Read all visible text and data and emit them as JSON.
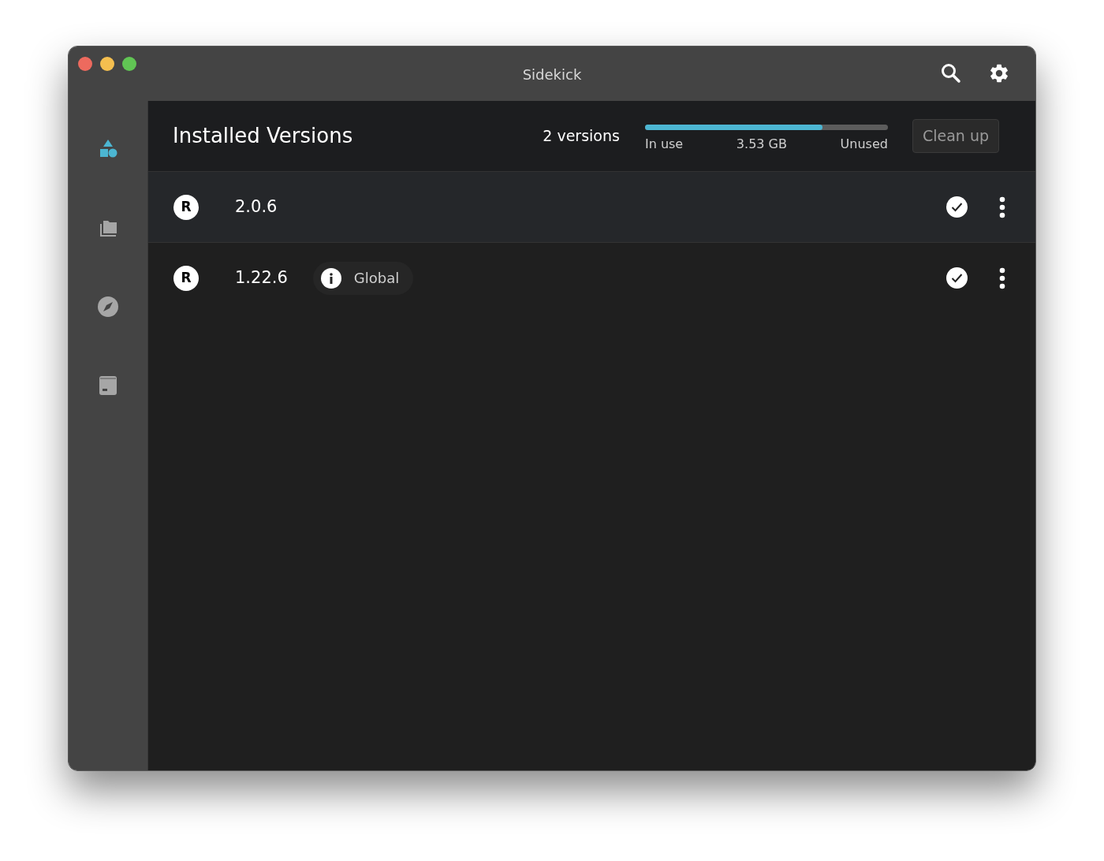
{
  "window": {
    "title": "Sidekick"
  },
  "sidebar": {
    "items": [
      {
        "kind": "shapes",
        "selected": true
      },
      {
        "kind": "folders",
        "selected": false
      },
      {
        "kind": "compass",
        "selected": false
      },
      {
        "kind": "archive",
        "selected": false
      }
    ]
  },
  "header": {
    "title": "Installed Versions",
    "count": "2 versions",
    "storage": {
      "level": 0.73,
      "in_use_label": "In use",
      "size": "3.53 GB",
      "unused_label": "Unused"
    },
    "cleanup_button": {
      "label": "Clean up",
      "disabled": true
    }
  },
  "versions": [
    {
      "badge": "R",
      "version": "2.0.6",
      "selected": true
    },
    {
      "badge": "R",
      "version": "1.22.6",
      "selected": false,
      "tag": "Global"
    }
  ]
}
